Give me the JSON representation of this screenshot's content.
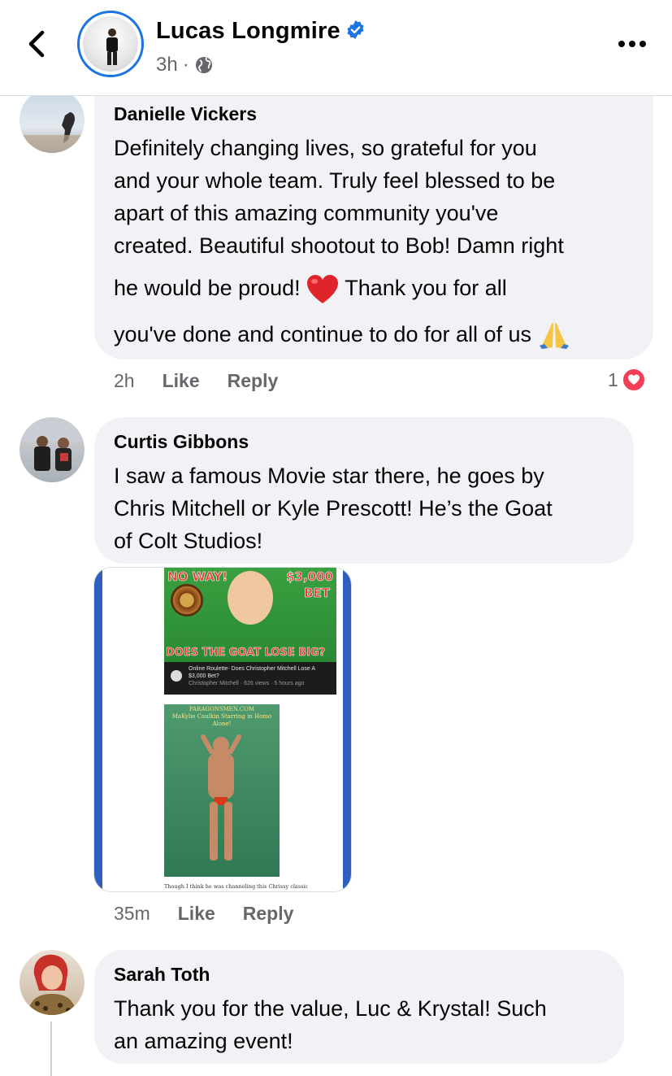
{
  "header": {
    "author": "Lucas Longmire",
    "time": "3h",
    "dot": "·"
  },
  "comments": [
    {
      "name": "Danielle Vickers",
      "lines": [
        "Definitely changing lives, so grateful for you",
        "and your whole team. Truly feel blessed to be",
        "apart of this amazing community you've",
        "created. Beautiful shootout to Bob! Damn right",
        "he would be proud!",
        "Thank you for all",
        "you've done and continue to do for all of us"
      ],
      "time": "2h",
      "like": "Like",
      "reply": "Reply",
      "reaction_count": "1"
    },
    {
      "name": "Curtis Gibbons",
      "lines": [
        "I saw a famous Movie star there, he goes by",
        "Chris Mitchell or Kyle Prescott! He’s the Goat",
        "of Colt Studios!"
      ],
      "time": "35m",
      "like": "Like",
      "reply": "Reply",
      "attachment": {
        "thumb_left": "NO WAY!",
        "thumb_right": "$3,000",
        "thumb_right2": "BET",
        "thumb_bottom": "DOES THE GOAT LOSE BIG?",
        "video_title": "Online Roulette- Does Christopher Mitchell Lose A $3,000 Bet?",
        "video_meta": "Christopher Mitchell · 626 views · 5 hours ago",
        "poster_site": "PARAGONSMEN.COM",
        "poster_title": "MaKylie Caulkin Starring in Homo Alone!",
        "caption": "Though I think he was channeling this Chrissy classic"
      }
    },
    {
      "name": "Sarah Toth",
      "lines": [
        "Thank you for the value, Luc & Krystal! Such",
        "an amazing event!"
      ]
    }
  ]
}
